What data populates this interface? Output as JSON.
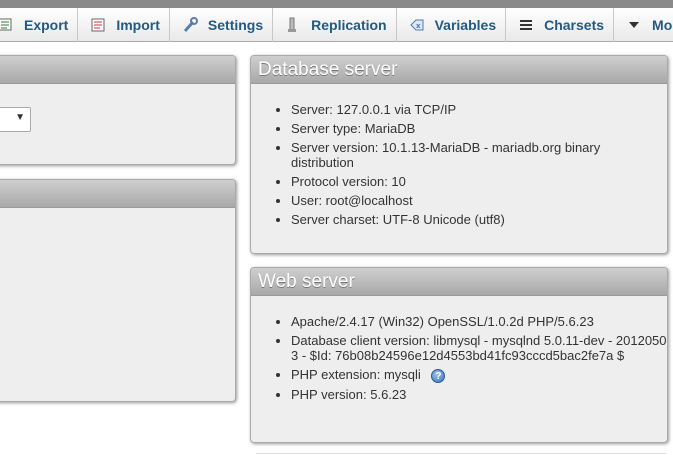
{
  "tabs": [
    {
      "label": "Export",
      "icon": "export-icon"
    },
    {
      "label": "Import",
      "icon": "import-icon"
    },
    {
      "label": "Settings",
      "icon": "wrench-icon"
    },
    {
      "label": "Replication",
      "icon": "replication-icon"
    },
    {
      "label": "Variables",
      "icon": "variables-icon"
    },
    {
      "label": "Charsets",
      "icon": "charsets-icon"
    },
    {
      "label": "More",
      "icon": "triangle-down-icon"
    }
  ],
  "db_server": {
    "title": "Database server",
    "items": [
      "Server: 127.0.0.1 via TCP/IP",
      "Server type: MariaDB",
      "Server version: 10.1.13-MariaDB - mariadb.org binary distribution",
      "Protocol version: 10",
      "User: root@localhost",
      "Server charset: UTF-8 Unicode (utf8)"
    ]
  },
  "web_server": {
    "title": "Web server",
    "items": [
      "Apache/2.4.17 (Win32) OpenSSL/1.0.2d PHP/5.6.23",
      "Database client version: libmysql - mysqlnd 5.0.11-dev - 20120503 - $Id: 76b08b24596e12d4553bd41fc93cccd5bac2fe7a $",
      "PHP extension: mysqli",
      "PHP version: 5.6.23"
    ],
    "help_glyph": "?"
  },
  "colors": {
    "tab_text": "#235a81",
    "panel_bg": "#eeeeee",
    "header_top": "#cfcfcf",
    "header_bottom": "#a8a8a8"
  }
}
